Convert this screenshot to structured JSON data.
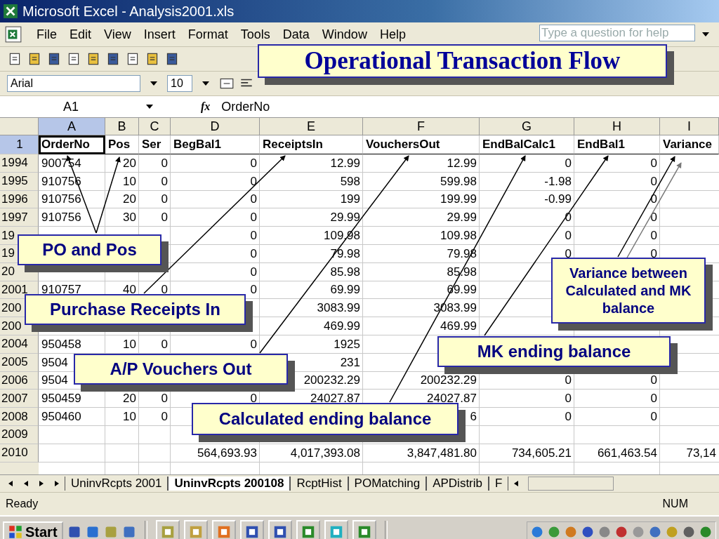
{
  "window": {
    "title": "Microsoft Excel - Analysis2001.xls"
  },
  "menu": [
    "File",
    "Edit",
    "View",
    "Insert",
    "Format",
    "Tools",
    "Data",
    "Window",
    "Help"
  ],
  "help_box": {
    "placeholder": "Type a question for help"
  },
  "font_box": {
    "value": "Arial"
  },
  "size_box": {
    "value": "10"
  },
  "formula_bar": {
    "name_box": "A1",
    "fx": "fx",
    "content": "OrderNo"
  },
  "columns": [
    {
      "letter": "A",
      "selected": true
    },
    {
      "letter": "B",
      "selected": false
    },
    {
      "letter": "C",
      "selected": false
    },
    {
      "letter": "D",
      "selected": false
    },
    {
      "letter": "E",
      "selected": false
    },
    {
      "letter": "F",
      "selected": false
    },
    {
      "letter": "G",
      "selected": false
    },
    {
      "letter": "H",
      "selected": false
    },
    {
      "letter": "I",
      "selected": false
    }
  ],
  "header_row": {
    "num": "1",
    "selected": true,
    "cells": [
      "OrderNo",
      "Pos",
      "Ser",
      "BegBal1",
      "ReceiptsIn",
      "VouchersOut",
      "EndBalCalc1",
      "EndBal1",
      "Variance"
    ]
  },
  "rows": [
    {
      "num": "1994",
      "cells": {
        "a": "900754",
        "b": "20",
        "c": "0",
        "d": "0",
        "e": "12.99",
        "f": "12.99",
        "g": "0",
        "h": "0"
      }
    },
    {
      "num": "1995",
      "cells": {
        "a": "910756",
        "b": "10",
        "c": "0",
        "d": "0",
        "e": "598",
        "f": "599.98",
        "g": "-1.98",
        "h": "0"
      }
    },
    {
      "num": "1996",
      "cells": {
        "a": "910756",
        "b": "20",
        "c": "0",
        "d": "0",
        "e": "199",
        "f": "199.99",
        "g": "-0.99",
        "h": "0"
      }
    },
    {
      "num": "1997",
      "cells": {
        "a": "910756",
        "b": "30",
        "c": "0",
        "d": "0",
        "e": "29.99",
        "f": "29.99",
        "g": "0",
        "h": "0"
      }
    },
    {
      "num": "19",
      "cells": {
        "d": "0",
        "e": "109.98",
        "f": "109.98",
        "g": "0",
        "h": "0"
      }
    },
    {
      "num": "19",
      "cells": {
        "d": "0",
        "e": "79.98",
        "f": "79.98",
        "g": "0",
        "h": "0"
      }
    },
    {
      "num": "20",
      "cells": {
        "d": "0",
        "e": "85.98",
        "f": "85.98"
      }
    },
    {
      "num": "2001",
      "cells": {
        "a": "910757",
        "b": "40",
        "c": "0",
        "d": "0",
        "e": "69.99",
        "f": "69.99"
      }
    },
    {
      "num": "200",
      "cells": {
        "e": "3083.99",
        "f": "3083.99"
      }
    },
    {
      "num": "200",
      "cells": {
        "e": "469.99",
        "f": "469.99"
      }
    },
    {
      "num": "2004",
      "cells": {
        "a": "950458",
        "b": "10",
        "c": "0",
        "d": "0",
        "e": "1925"
      }
    },
    {
      "num": "2005",
      "cells": {
        "a": "9504",
        "e": "231"
      }
    },
    {
      "num": "2006",
      "cells": {
        "a": "9504",
        "e": "200232.29",
        "f": "200232.29",
        "g": "0",
        "h": "0"
      }
    },
    {
      "num": "2007",
      "cells": {
        "a": "950459",
        "b": "20",
        "c": "0",
        "d": "0",
        "e": "24027.87",
        "f": "24027.87",
        "g": "0",
        "h": "0"
      }
    },
    {
      "num": "2008",
      "cells": {
        "a": "950460",
        "b": "10",
        "c": "0",
        "f": "6",
        "g": "0",
        "h": "0"
      }
    },
    {
      "num": "2009",
      "cells": {}
    },
    {
      "num": "2010",
      "cells": {
        "d": "564,693.93",
        "e": "4,017,393.08",
        "f": "3,847,481.80",
        "g": "734,605.21",
        "h": "661,463.54",
        "i": "73,14"
      }
    }
  ],
  "sheet_tabs": [
    {
      "label": "UninvRcpts 2001",
      "selected": false
    },
    {
      "label": "UninvRcpts 200108",
      "selected": true
    },
    {
      "label": "RcptHist",
      "selected": false
    },
    {
      "label": "POMatching",
      "selected": false
    },
    {
      "label": "APDistrib",
      "selected": false
    },
    {
      "label": "F",
      "selected": false
    }
  ],
  "status_bar": {
    "status": "Ready",
    "indicator": "NUM"
  },
  "taskbar": {
    "start": "Start"
  },
  "callouts": [
    {
      "kind": "title",
      "text": "Operational Transaction Flow"
    },
    {
      "kind": "note",
      "text": "PO and Pos"
    },
    {
      "kind": "note",
      "text": "Purchase Receipts In"
    },
    {
      "kind": "note",
      "text": "A/P Vouchers Out"
    },
    {
      "kind": "note",
      "text": "Calculated ending balance"
    },
    {
      "kind": "note",
      "text": "MK ending balance"
    },
    {
      "kind": "note",
      "text": "Variance between Calculated and MK balance"
    }
  ]
}
